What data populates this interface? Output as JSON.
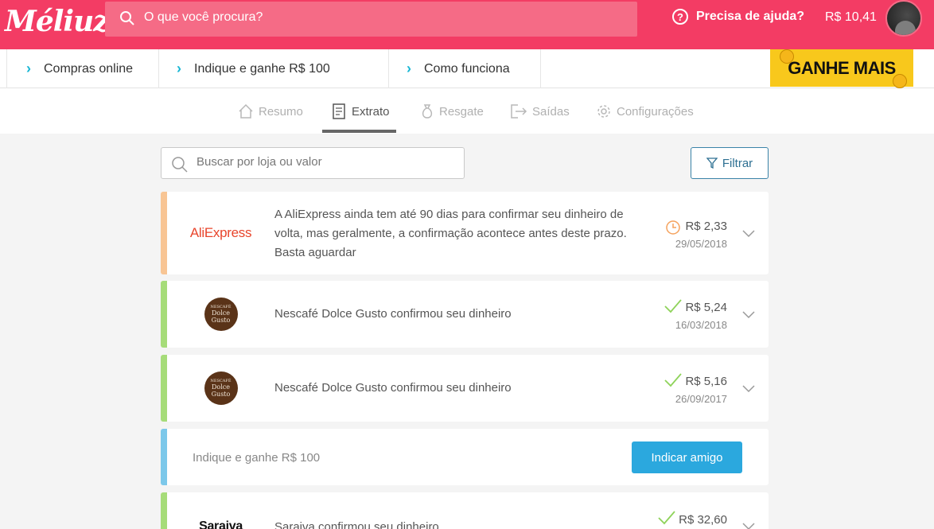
{
  "header": {
    "logo_text": "Méliuz",
    "search_placeholder": "O que você procura?",
    "help_label": "Precisa de ajuda?",
    "balance": "R$ 10,41",
    "brand_color": "#f33c64"
  },
  "subnav": {
    "items": [
      {
        "label": "Compras online"
      },
      {
        "label": "Indique e ganhe R$ 100"
      },
      {
        "label": "Como funciona"
      }
    ],
    "promo_label": "GANHE MAIS"
  },
  "tabs": [
    {
      "label": "Resumo",
      "icon": "home-icon",
      "active": false
    },
    {
      "label": "Extrato",
      "icon": "receipt-icon",
      "active": true
    },
    {
      "label": "Resgate",
      "icon": "money-bag-icon",
      "active": false
    },
    {
      "label": "Saídas",
      "icon": "exit-icon",
      "active": false
    },
    {
      "label": "Configurações",
      "icon": "gear-icon",
      "active": false
    }
  ],
  "content": {
    "search_placeholder": "Buscar por loja ou valor",
    "filter_label": "Filtrar",
    "transactions": [
      {
        "store_logo": "AliExpress",
        "message": "A AliExpress ainda tem até 90 dias para confirmar seu dinheiro de volta, mas geralmente, a confirmação acontece antes deste prazo. Basta aguardar",
        "amount": "R$ 2,33",
        "date": "29/05/2018",
        "status": "pending",
        "status_color": "#f5a25d"
      },
      {
        "store_logo": "Nescafé Dolce Gusto",
        "message": "Nescafé Dolce Gusto confirmou seu dinheiro",
        "amount": "R$ 5,24",
        "date": "16/03/2018",
        "status": "confirmed",
        "status_color": "#9fd86b"
      },
      {
        "store_logo": "Nescafé Dolce Gusto",
        "message": "Nescafé Dolce Gusto confirmou seu dinheiro",
        "amount": "R$ 5,16",
        "date": "26/09/2017",
        "status": "confirmed",
        "status_color": "#9fd86b"
      },
      {
        "store_logo": "Saraiva",
        "message": "Saraiva confirmou seu dinheiro",
        "amount": "R$ 32,60",
        "date": "",
        "status": "confirmed",
        "status_color": "#9fd86b"
      }
    ],
    "invite": {
      "text": "Indique e ganhe R$ 100",
      "button_label": "Indicar amigo",
      "accent_color": "#7cc8ea"
    }
  }
}
